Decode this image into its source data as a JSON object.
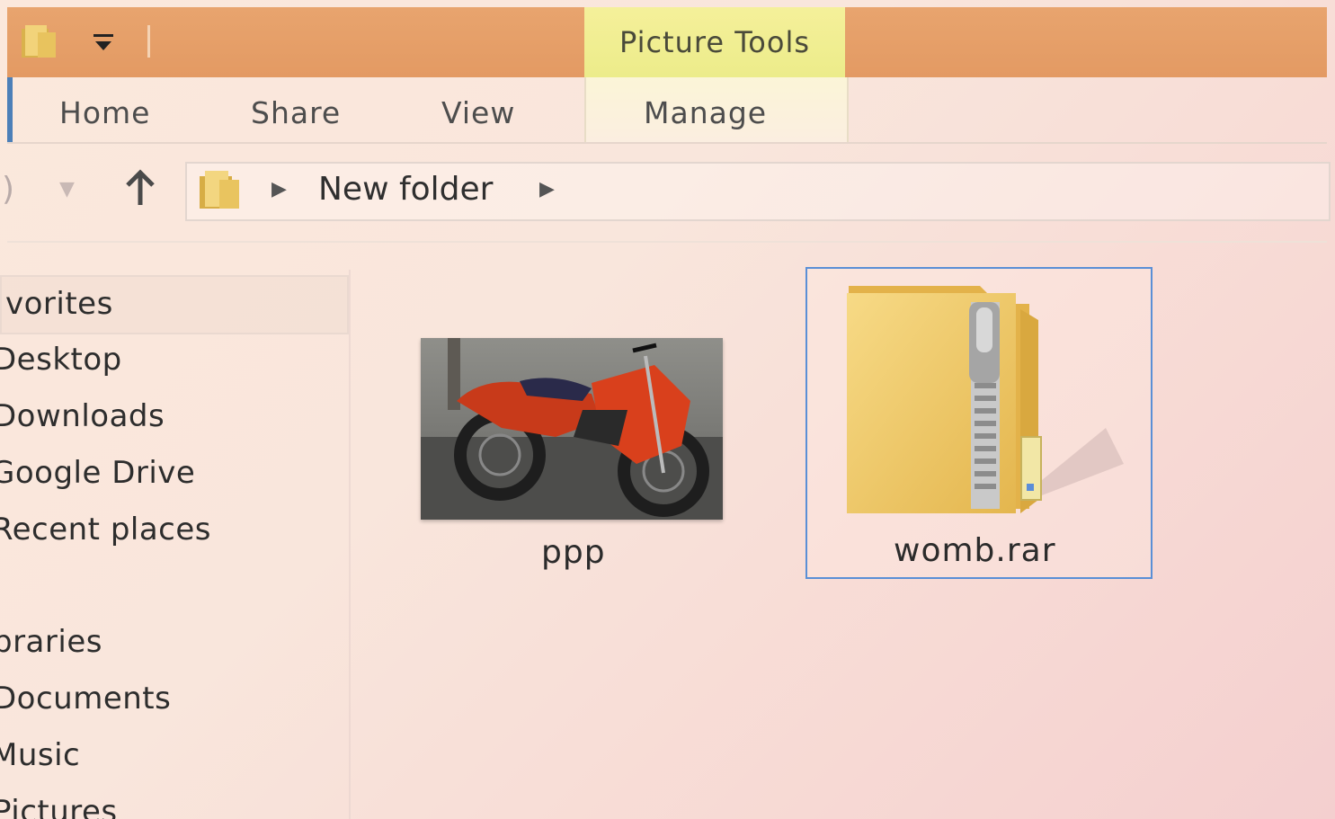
{
  "titlebar": {
    "context_tab_label": "Picture Tools",
    "colors": {
      "titlebar": "#e39a63",
      "context_tab": "#ecec8a",
      "selection": "#5a8fd6"
    }
  },
  "quick_access": {
    "folder_icon": "folder-icon",
    "dropdown_icon": "customize-dropdown-icon"
  },
  "ribbon": {
    "tabs": [
      {
        "label": "Home"
      },
      {
        "label": "Share"
      },
      {
        "label": "View"
      },
      {
        "label": "Manage"
      }
    ]
  },
  "navigation": {
    "back_icon": "back-icon",
    "forward_icon": "forward-dropdown-icon",
    "up_icon": "up-arrow-icon",
    "breadcrumb": [
      "New folder"
    ]
  },
  "sidebar": {
    "favorites_header": "vorites",
    "favorites": [
      "Desktop",
      "Downloads",
      "Google Drive",
      "Recent places"
    ],
    "favorites_visible": [
      "Desktop",
      "Downloads",
      "Google Drive",
      "Recent places"
    ],
    "libraries_header": "praries",
    "libraries": [
      "Documents",
      "Music",
      "Pictures"
    ],
    "visible_text": {
      "favorites": ")esktop|)ownloads|Google Drive|Recent places",
      "libraries": ")ocuments|Music|Pictures"
    }
  },
  "files": [
    {
      "name": "ppp",
      "type": "image",
      "icon": "motorcycle-thumbnail"
    },
    {
      "name": "womb.rar",
      "type": "archive",
      "icon": "zip-folder-icon",
      "selected": true
    }
  ]
}
